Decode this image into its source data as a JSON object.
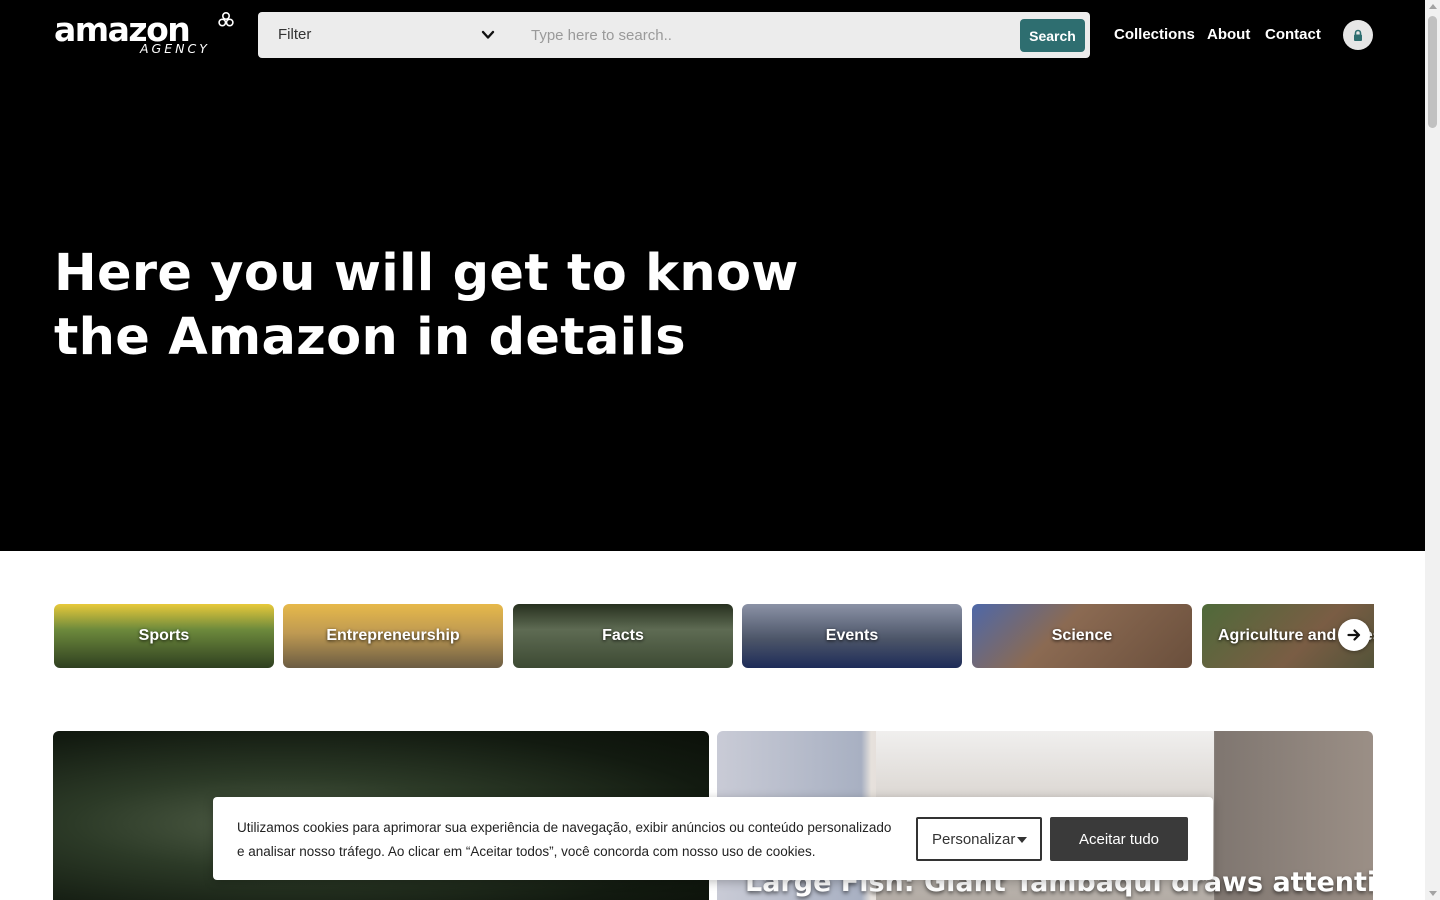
{
  "brand": {
    "logo_main": "amazon",
    "logo_sub": "AGENCY"
  },
  "header": {
    "filter_label": "Filter",
    "search_placeholder": "Type here to search..",
    "search_button": "Search",
    "nav": [
      {
        "label": "Collections"
      },
      {
        "label": "About"
      },
      {
        "label": "Contact"
      }
    ],
    "lock_icon": "lock-icon"
  },
  "hero": {
    "title_line1": "Here you will get to know",
    "title_line2": "the Amazon in details"
  },
  "categories": [
    {
      "label": "Sports",
      "color": "#4a6b2a"
    },
    {
      "label": "Entrepreneurship",
      "color": "#8c7a4a"
    },
    {
      "label": "Facts",
      "color": "#3f4a35"
    },
    {
      "label": "Events",
      "color": "#4c5568"
    },
    {
      "label": "Science",
      "color": "#7a5d48"
    },
    {
      "label": "Agriculture and Livestock",
      "color": "#5e4b36"
    }
  ],
  "articles": [
    {
      "title": ""
    },
    {
      "title": "Large Fish: Giant Tambaqui draws attention"
    }
  ],
  "cookie_banner": {
    "text": "Utilizamos cookies para aprimorar sua experiência de navegação, exibir anúncios ou conteúdo personalizado e analisar nosso tráfego. Ao clicar em “Aceitar todos”, você concorda com nosso uso de cookies.",
    "customize_label": "Personalizar",
    "accept_label": "Aceitar tudo"
  },
  "colors": {
    "accent": "#2e6e70",
    "hero_bg": "#000000",
    "cookie_accept_bg": "#3a3a3a"
  }
}
